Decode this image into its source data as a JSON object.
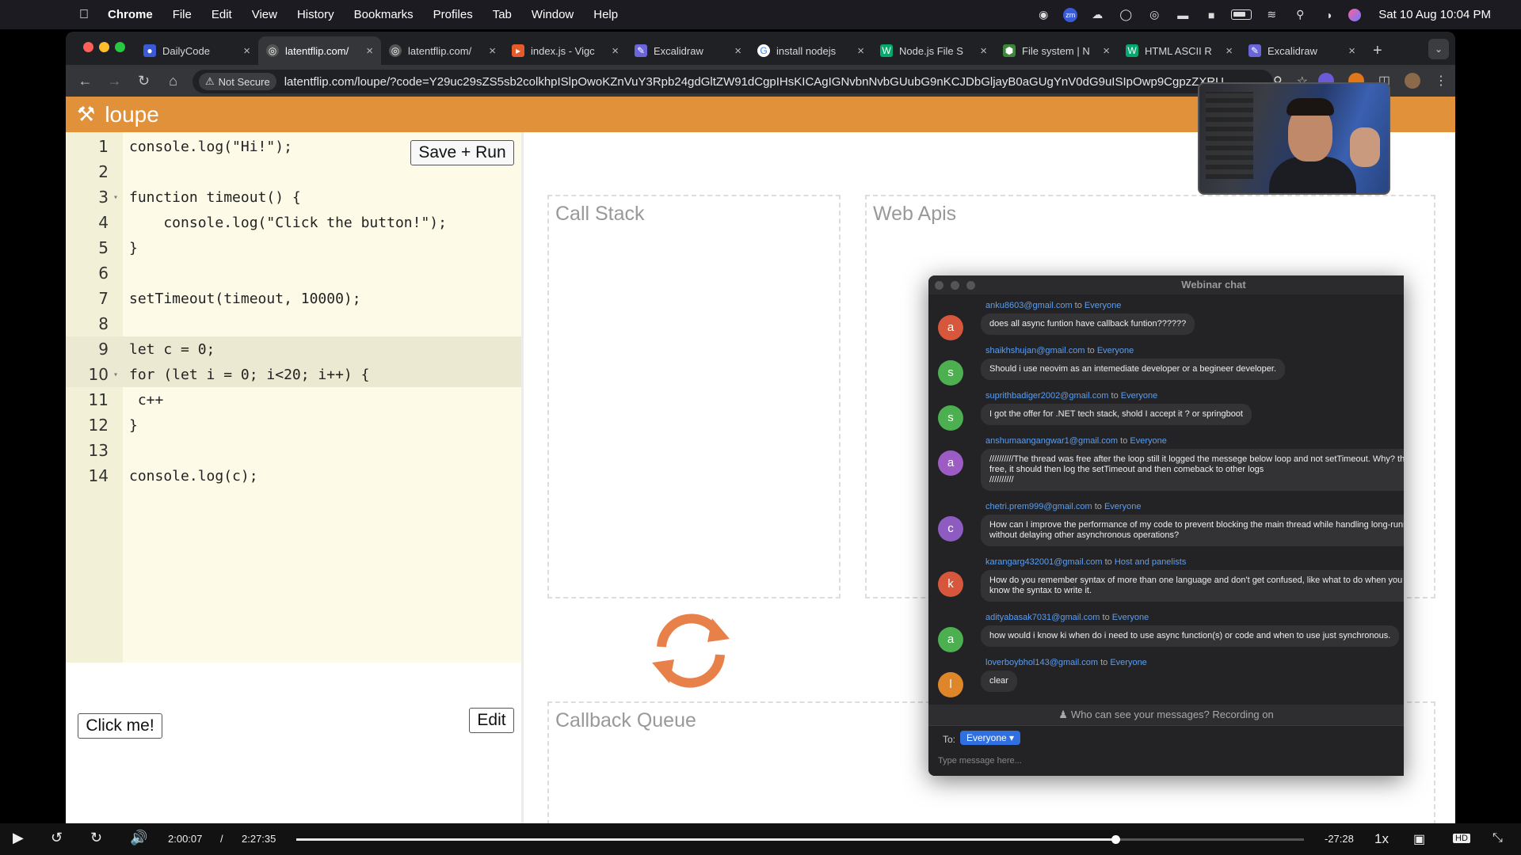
{
  "menubar": {
    "app": "Chrome",
    "items": [
      "File",
      "Edit",
      "View",
      "History",
      "Bookmarks",
      "Profiles",
      "Tab",
      "Window",
      "Help"
    ],
    "clock": "Sat 10 Aug  10:04 PM"
  },
  "browser": {
    "tabs": [
      {
        "title": "DailyCode",
        "icon": "dailycode-icon",
        "active": false
      },
      {
        "title": "latentflip.com/",
        "icon": "globe-icon",
        "active": true
      },
      {
        "title": "latentflip.com/",
        "icon": "globe-icon",
        "active": false
      },
      {
        "title": "index.js - Vigc",
        "icon": "codesandbox-icon",
        "active": false
      },
      {
        "title": "Excalidraw",
        "icon": "excalidraw-icon",
        "active": false
      },
      {
        "title": "install nodejs",
        "icon": "google-icon",
        "active": false
      },
      {
        "title": "Node.js File S",
        "icon": "w3schools-icon",
        "active": false
      },
      {
        "title": "File system | N",
        "icon": "nodejs-icon",
        "active": false
      },
      {
        "title": "HTML ASCII R",
        "icon": "w3schools-icon",
        "active": false
      },
      {
        "title": "Excalidraw",
        "icon": "excalidraw-icon",
        "active": false
      }
    ],
    "security_label": "Not Secure",
    "url": "latentflip.com/loupe/?code=Y29uc29sZS5sb2colkhpISlpOwoKZnVuY3Rpb24gdGltZW91dCgpIHsKICAgIGNvbnNvbGUubG9nKCJDbGljayB0aGUgYnV0dG9uISIpOwp9CgpzZXRU..."
  },
  "loupe": {
    "brand": "loupe",
    "save_button": "Save + Run",
    "edit_button": "Edit",
    "click_button": "Click me!",
    "code_lines": [
      {
        "n": "1",
        "fold": "",
        "code": "console.log(\"Hi!\");",
        "highlight": false
      },
      {
        "n": "2",
        "fold": "",
        "code": "",
        "highlight": false
      },
      {
        "n": "3",
        "fold": "▾",
        "code": "function timeout() {",
        "highlight": false
      },
      {
        "n": "4",
        "fold": "",
        "code": "    console.log(\"Click the button!\");",
        "highlight": false
      },
      {
        "n": "5",
        "fold": "",
        "code": "}",
        "highlight": false
      },
      {
        "n": "6",
        "fold": "",
        "code": "",
        "highlight": false
      },
      {
        "n": "7",
        "fold": "",
        "code": "setTimeout(timeout, 10000);",
        "highlight": false
      },
      {
        "n": "8",
        "fold": "",
        "code": "",
        "highlight": false
      },
      {
        "n": "9",
        "fold": "",
        "code": "let c = 0;",
        "highlight": true
      },
      {
        "n": "10",
        "fold": "▾",
        "code": "for (let i = 0; i<20; i++) {",
        "highlight": true
      },
      {
        "n": "11",
        "fold": "",
        "code": " c++",
        "highlight": false
      },
      {
        "n": "12",
        "fold": "",
        "code": "}",
        "highlight": false
      },
      {
        "n": "13",
        "fold": "",
        "code": "",
        "highlight": false
      },
      {
        "n": "14",
        "fold": "",
        "code": "console.log(c);",
        "highlight": false
      }
    ],
    "panels": {
      "call_stack": "Call Stack",
      "web_apis": "Web Apis",
      "callback_queue": "Callback Queue"
    },
    "accent_color": "#e0913a"
  },
  "chat": {
    "title": "Webinar chat",
    "messages": [
      {
        "from": "anku8603@gmail.com",
        "to": "Everyone",
        "avatar": "a",
        "color": "#d6573c",
        "lines": [
          "does all async funtion have callback funtion??????"
        ]
      },
      {
        "from": "shaikhshujan@gmail.com",
        "to": "Everyone",
        "avatar": "s",
        "color": "#4caf50",
        "lines": [
          "Should i use neovim as an intemediate developer or a begineer developer."
        ]
      },
      {
        "from": "suprithbadiger2002@gmail.com",
        "to": "Everyone",
        "avatar": "s",
        "color": "#4caf50",
        "lines": [
          "I got the offer for .NET tech stack, shold I accept it ? or springboot"
        ]
      },
      {
        "from": "anshumaangangwar1@gmail.com",
        "to": "Everyone",
        "avatar": "a",
        "color": "#9c5cc4",
        "lines": [
          "//////////The thread was free after the loop still it logged the messege below loop and not setTimeout. Why? the loop was co",
          "free, it should then log the setTimeout and then comeback to other logs",
          "//////////"
        ]
      },
      {
        "from": "chetri.prem999@gmail.com",
        "to": "Everyone",
        "avatar": "c",
        "color": "#8e5cc0",
        "lines": [
          "How can I improve the performance of my code to prevent blocking the main thread while handling long-running tasks, like",
          "without delaying other asynchronous operations?"
        ]
      },
      {
        "from": "karangarg432001@gmail.com",
        "to": "Host and panelists",
        "avatar": "k",
        "color": "#d6573c",
        "lines": [
          "How do you remember syntax of more than one language and don't get confused, like what to do when you know all of the",
          "know the syntax to write it."
        ]
      },
      {
        "from": "adityabasak7031@gmail.com",
        "to": "Everyone",
        "avatar": "a",
        "color": "#4caf50",
        "lines": [
          "how would i know ki when do i need to use async function(s) or code and when to use just synchronous."
        ]
      },
      {
        "from": "loverboybhol143@gmail.com",
        "to": "Everyone",
        "avatar": "l",
        "color": "#e0862a",
        "lines": [
          "clear"
        ]
      }
    ],
    "recording_note": "Who can see your messages? Recording on",
    "to_label": "To:",
    "to_value": "Everyone",
    "placeholder": "Type message here..."
  },
  "player": {
    "current": "2:00:07",
    "separator": "/",
    "total": "2:27:35",
    "remaining": "-27:28",
    "speed": "1x",
    "progress": 0.813
  }
}
